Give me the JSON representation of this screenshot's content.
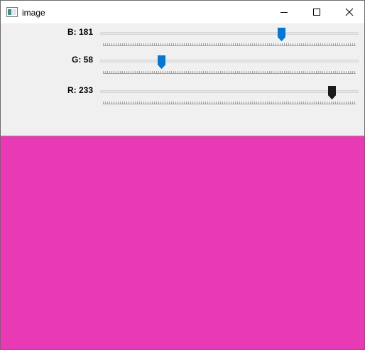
{
  "window": {
    "title": "image",
    "icon": "window-app-icon",
    "buttons": {
      "minimize": "minimize-icon",
      "maximize": "maximize-icon",
      "close": "close-icon"
    }
  },
  "trackbars": [
    {
      "label": "B: 181",
      "value": 181,
      "max": 255,
      "focused": false
    },
    {
      "label": "G: 58",
      "value": 58,
      "max": 255,
      "focused": false
    },
    {
      "label": "R: 233",
      "value": 233,
      "max": 255,
      "focused": true
    }
  ],
  "preview": {
    "color": "#e93ab5"
  },
  "colors": {
    "thumb": "#0078d7",
    "thumb_focused": "#1a1a1a",
    "panel": "#f0f0f0"
  }
}
